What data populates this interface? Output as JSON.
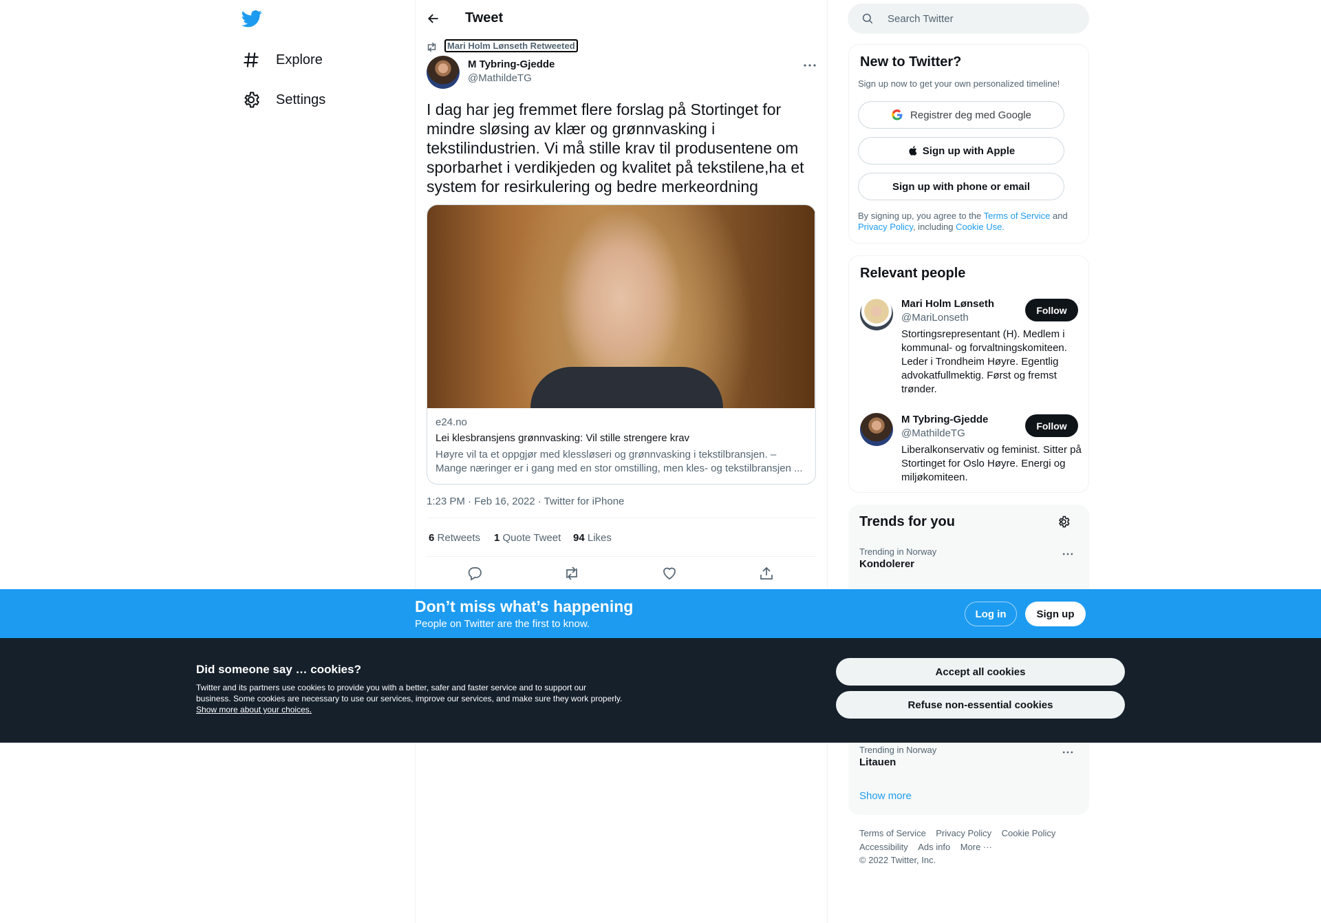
{
  "nav": {
    "items": [
      {
        "label": "Explore",
        "icon": "hashtag-icon"
      },
      {
        "label": "Settings",
        "icon": "gear-icon"
      }
    ]
  },
  "header": {
    "title": "Tweet"
  },
  "tweet": {
    "retweeted_by": "Mari Holm Lønseth Retweeted",
    "author_name": "M Tybring-Gjedde",
    "author_handle": "@MathildeTG",
    "text": "I dag har jeg fremmet flere forslag på Stortinget for mindre sløsing av klær og grønnvasking i tekstilindustrien. Vi må stille krav til produsentene om sporbarhet i verdikjeden og kvalitet på tekstilene,ha et system for resirkulering og bedre merkeordning",
    "card": {
      "domain": "e24.no",
      "title": "Lei klesbransjens grønnvasking: Vil stille strengere krav",
      "description_line1": "Høyre vil ta et oppgjør med klessløseri og grønnvasking i tekstilbransjen. –",
      "description_line2": "Mange næringer er i gang med en stor omstilling, men kles- og tekstilbransjen ..."
    },
    "meta": "1:23 PM · Feb 16, 2022 · Twitter for iPhone",
    "stats": {
      "retweets_count": "6",
      "retweets_label": "Retweets",
      "quotes_count": "1",
      "quotes_label": "Quote Tweet",
      "likes_count": "94",
      "likes_label": "Likes"
    }
  },
  "search": {
    "placeholder": "Search Twitter"
  },
  "new_to_twitter": {
    "title": "New to Twitter?",
    "subtitle": "Sign up now to get your own personalized timeline!",
    "google_label": "Registrer deg med Google",
    "apple_label": "Sign up with Apple",
    "phone_label": "Sign up with phone or email",
    "terms_prefix": "By signing up, you agree to the ",
    "terms_link": "Terms of Service",
    "terms_and": " and",
    "privacy_link": "Privacy Policy",
    "including": ", including ",
    "cookie_link": "Cookie Use."
  },
  "relevant_people": {
    "title": "Relevant people",
    "people": [
      {
        "name": "Mari Holm Lønseth",
        "handle": "@MariLonseth",
        "follow_label": "Follow",
        "bio": "Stortingsrepresentant (H). Medlem i kommunal- og forvaltningskomiteen. Leder i Trondheim Høyre. Egentlig advokatfullmektig. Først og fremst trønder."
      },
      {
        "name": "M Tybring-Gjedde",
        "handle": "@MathildeTG",
        "follow_label": "Follow",
        "bio": "Liberalkonservativ og feminist. Sitter på Stortinget for Oslo Høyre. Energi og miljøkomiteen."
      }
    ]
  },
  "trends": {
    "title": "Trends for you",
    "items": [
      {
        "category": "Trending in Norway",
        "name": "Kondolerer"
      },
      {
        "category": "Trending in Norway",
        "name": "Litauen"
      }
    ],
    "show_more": "Show more"
  },
  "footer": {
    "links_row1": [
      "Terms of Service",
      "Privacy Policy",
      "Cookie Policy"
    ],
    "links_row2": [
      "Accessibility",
      "Ads info",
      "More ···"
    ],
    "copyright": "© 2022 Twitter, Inc."
  },
  "banner": {
    "title": "Don’t miss what’s happening",
    "subtitle": "People on Twitter are the first to know.",
    "login_label": "Log in",
    "signup_label": "Sign up"
  },
  "cookies": {
    "title": "Did someone say … cookies?",
    "text": "Twitter and its partners use cookies to provide you with a better, safer and faster service and to support our business. Some cookies are necessary to use our services, improve our services, and make sure they work properly. ",
    "more_link": "Show more about your choices.",
    "accept_label": "Accept all cookies",
    "refuse_label": "Refuse non-essential cookies"
  },
  "colors": {
    "brand": "#1d9bf0",
    "text": "#0f1419",
    "secondary": "#536471",
    "cookie_bg": "#15202b"
  }
}
